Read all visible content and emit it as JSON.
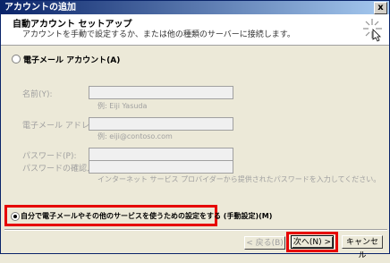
{
  "window": {
    "title": "アカウントの追加",
    "close_glyph": "x"
  },
  "header": {
    "title": "自動アカウント セットアップ",
    "description": "アカウントを手動で設定するか、または他の種類のサーバーに接続します。",
    "icon": "setup-spark-icon"
  },
  "email_account": {
    "label": "電子メール アカウント(A)",
    "selected": false,
    "name_label": "名前(Y):",
    "name_value": "",
    "name_hint": "例: Eiji Yasuda",
    "email_label": "電子メール アドレス(E):",
    "email_value": "",
    "email_hint": "例: eiji@contoso.com",
    "password_label": "パスワード(P):",
    "password_value": "",
    "password_confirm_label": "パスワードの確認入力(T):",
    "password_confirm_value": "",
    "password_hint": "インターネット サービス プロバイダーから提供されたパスワードを入力してください。"
  },
  "manual_setup": {
    "label": "自分で電子メールやその他のサービスを使うための設定をする (手動設定)(M)",
    "selected": true
  },
  "buttons": {
    "back": "< 戻る(B)",
    "next": "次へ(N) >",
    "cancel": "キャンセル"
  },
  "colors": {
    "highlight": "#e60000",
    "titlebar": "#0a246a"
  }
}
